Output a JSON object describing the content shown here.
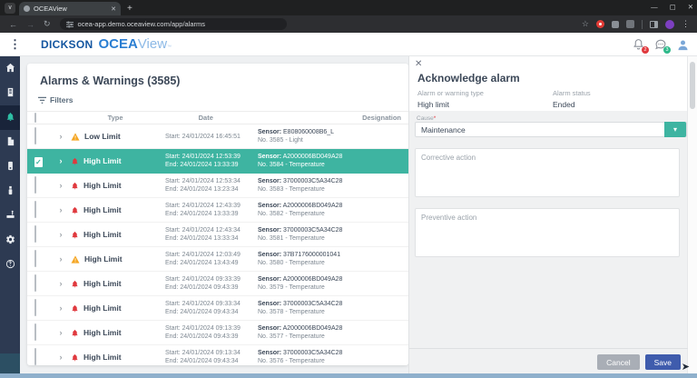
{
  "browser": {
    "tab_title": "OCEAView",
    "url": "ocea-app.demo.oceaview.com/app/alarms",
    "window_controls": {
      "minimize": "—",
      "maximize": "▢",
      "close": "✕"
    },
    "nav_icons": [
      "back-arrow",
      "forward-arrow",
      "reload"
    ],
    "toolbar_icons": [
      "bookmark-star",
      "record-indicator",
      "extension",
      "extensions-puzzle",
      "side-panel",
      "profile-avatar",
      "menu-kebab"
    ]
  },
  "header": {
    "brand_dickson": "DICKSON",
    "brand_ocea": "OCEA",
    "brand_view": "View",
    "brand_tm": "™",
    "bell_badge": "2",
    "chat_badge": "3"
  },
  "sidebar": {
    "items": [
      {
        "name": "home",
        "icon": "home-icon",
        "active": false
      },
      {
        "name": "dataloggers",
        "icon": "datalogger-icon",
        "active": false
      },
      {
        "name": "alarms",
        "icon": "bell-icon",
        "active": true
      },
      {
        "name": "reports",
        "icon": "report-icon",
        "active": false
      },
      {
        "name": "devices",
        "icon": "device-icon",
        "active": false
      },
      {
        "name": "sensors",
        "icon": "sensor-icon",
        "active": false
      },
      {
        "name": "gateways",
        "icon": "gateway-icon",
        "active": false
      },
      {
        "name": "settings",
        "icon": "gear-icon",
        "active": false
      },
      {
        "name": "help",
        "icon": "help-icon",
        "active": false
      }
    ]
  },
  "main": {
    "title": "Alarms & Warnings (3585)",
    "filters_label": "Filters",
    "sensor_prefix": "Sensor:",
    "columns": {
      "type": "Type",
      "date": "Date",
      "designation": "Designation"
    },
    "rows": [
      {
        "type": "Low Limit",
        "icon": "warning",
        "start": "Start: 24/01/2024 16:45:51",
        "end": "",
        "sensor": "E808060008B6_L",
        "no": "No. 3585 - Light",
        "selected": false,
        "checked": false
      },
      {
        "type": "High Limit",
        "icon": "bell",
        "start": "Start: 24/01/2024 12:53:39",
        "end": "End: 24/01/2024 13:33:39",
        "sensor": "A2000006BD049A28",
        "no": "No. 3584 - Temperature",
        "selected": true,
        "checked": true
      },
      {
        "type": "High Limit",
        "icon": "bell",
        "start": "Start: 24/01/2024 12:53:34",
        "end": "End: 24/01/2024 13:23:34",
        "sensor": "37000003C5A34C28",
        "no": "No. 3583 - Temperature",
        "selected": false,
        "checked": false
      },
      {
        "type": "High Limit",
        "icon": "bell",
        "start": "Start: 24/01/2024 12:43:39",
        "end": "End: 24/01/2024 13:33:39",
        "sensor": "A2000006BD049A28",
        "no": "No. 3582 - Temperature",
        "selected": false,
        "checked": false
      },
      {
        "type": "High Limit",
        "icon": "bell",
        "start": "Start: 24/01/2024 12:43:34",
        "end": "End: 24/01/2024 13:33:34",
        "sensor": "37000003C5A34C28",
        "no": "No. 3581 - Temperature",
        "selected": false,
        "checked": false
      },
      {
        "type": "High Limit",
        "icon": "warning",
        "start": "Start: 24/01/2024 12:03:49",
        "end": "End: 24/01/2024 13:43:49",
        "sensor": "37B7176000001041",
        "no": "No. 3580 - Temperature",
        "selected": false,
        "checked": false
      },
      {
        "type": "High Limit",
        "icon": "bell",
        "start": "Start: 24/01/2024 09:33:39",
        "end": "End: 24/01/2024 09:43:39",
        "sensor": "A2000006BD049A28",
        "no": "No. 3579 - Temperature",
        "selected": false,
        "checked": false
      },
      {
        "type": "High Limit",
        "icon": "bell",
        "start": "Start: 24/01/2024 09:33:34",
        "end": "End: 24/01/2024 09:43:34",
        "sensor": "37000003C5A34C28",
        "no": "No. 3578 - Temperature",
        "selected": false,
        "checked": false
      },
      {
        "type": "High Limit",
        "icon": "bell",
        "start": "Start: 24/01/2024 09:13:39",
        "end": "End: 24/01/2024 09:43:39",
        "sensor": "A2000006BD049A28",
        "no": "No. 3577 - Temperature",
        "selected": false,
        "checked": false
      },
      {
        "type": "High Limit",
        "icon": "bell",
        "start": "Start: 24/01/2024 09:13:34",
        "end": "End: 24/01/2024 09:43:34",
        "sensor": "37000003C5A34C28",
        "no": "No. 3576 - Temperature",
        "selected": false,
        "checked": false
      }
    ]
  },
  "panel": {
    "close": "✕",
    "title": "Acknowledge alarm",
    "type_label": "Alarm or warning type",
    "type_value": "High limit",
    "status_label": "Alarm status",
    "status_value": "Ended",
    "cause_label": "Cause",
    "required_mark": "*",
    "cause_value": "Maintenance",
    "corrective_placeholder": "Corrective action",
    "preventive_placeholder": "Preventive action",
    "cancel_label": "Cancel",
    "save_label": "Save"
  },
  "colors": {
    "accent_teal": "#3eb4a1",
    "alarm_red": "#e0393e",
    "warning_orange": "#f5a623",
    "save_blue": "#3f5cad",
    "sidebar_navy": "#2d3a52"
  }
}
